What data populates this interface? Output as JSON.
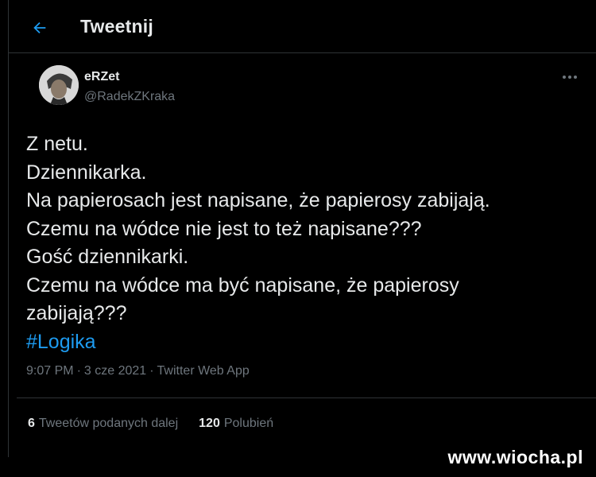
{
  "header": {
    "title": "Tweetnij"
  },
  "tweet": {
    "display_name": "eRZet",
    "handle": "@RadekZKraka",
    "lines": [
      "Z netu.",
      "Dziennikarka.",
      "Na papierosach jest napisane, że papierosy zabijają.",
      "Czemu na wódce nie jest to też napisane???",
      "Gość dziennikarki.",
      "Czemu na wódce ma być napisane, że papierosy",
      "zabijają???"
    ],
    "hashtag": "#Logika",
    "time": "9:07 PM",
    "date": "3 cze 2021",
    "source": "Twitter Web App",
    "separator": "·"
  },
  "stats": {
    "retweets_count": "6",
    "retweets_label": "Tweetów podanych dalej",
    "likes_count": "120",
    "likes_label": "Polubień"
  },
  "watermark": {
    "text": "www.wiocha.pl"
  },
  "colors": {
    "accent": "#1d9bf0",
    "muted": "#6e767d",
    "text": "#e7e9ea",
    "background": "#000000"
  }
}
